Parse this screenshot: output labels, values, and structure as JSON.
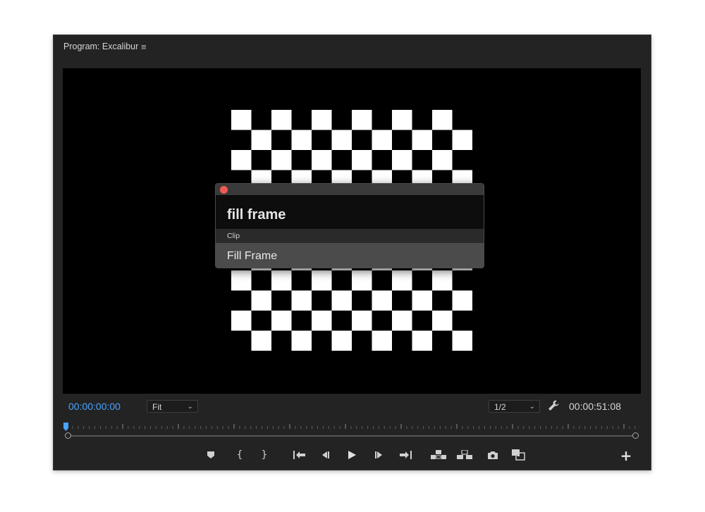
{
  "panel": {
    "title": "Program: Excalibur",
    "menu_icon": "hamburger-icon"
  },
  "command_palette": {
    "query": "fill frame",
    "section": "Clip",
    "result": "Fill Frame",
    "close_color": "#ee5a52"
  },
  "timecode": {
    "current": "00:00:00:00",
    "duration": "00:00:51:08",
    "current_color": "#4aa3ff"
  },
  "zoom": {
    "selected": "Fit"
  },
  "resolution": {
    "selected": "1/2"
  },
  "transport": {
    "mark_in_label": "{",
    "mark_out_label": "}",
    "add_button_label": "+"
  }
}
